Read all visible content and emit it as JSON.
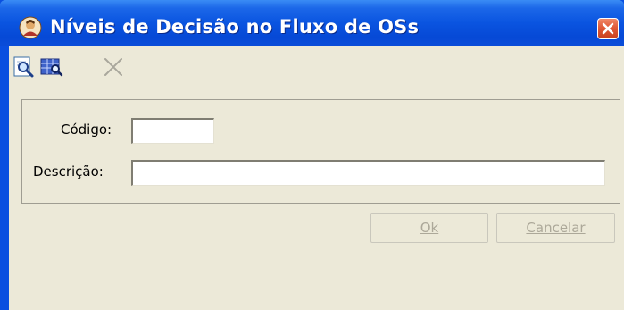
{
  "window": {
    "title": "Níveis de Decisão no Fluxo de OSs",
    "title_icon": "user-avatar-icon",
    "close_icon": "close-icon"
  },
  "toolbar": {
    "buttons": [
      {
        "icon": "search-icon",
        "enabled": true
      },
      {
        "icon": "grid-search-icon",
        "enabled": true
      },
      {
        "icon": "delete-x-icon",
        "enabled": false
      }
    ]
  },
  "form": {
    "codigo_label": "Código:",
    "codigo_value": "",
    "descricao_label": "Descrição:",
    "descricao_value": ""
  },
  "actions": {
    "ok_label": "Ok",
    "cancel_label": "Cancelar",
    "ok_enabled": false,
    "cancel_enabled": false
  },
  "colors": {
    "titlebar": "#0a54e0",
    "client_bg": "#ece9d8",
    "close_button": "#e05a38",
    "disabled_text": "#aca899"
  }
}
